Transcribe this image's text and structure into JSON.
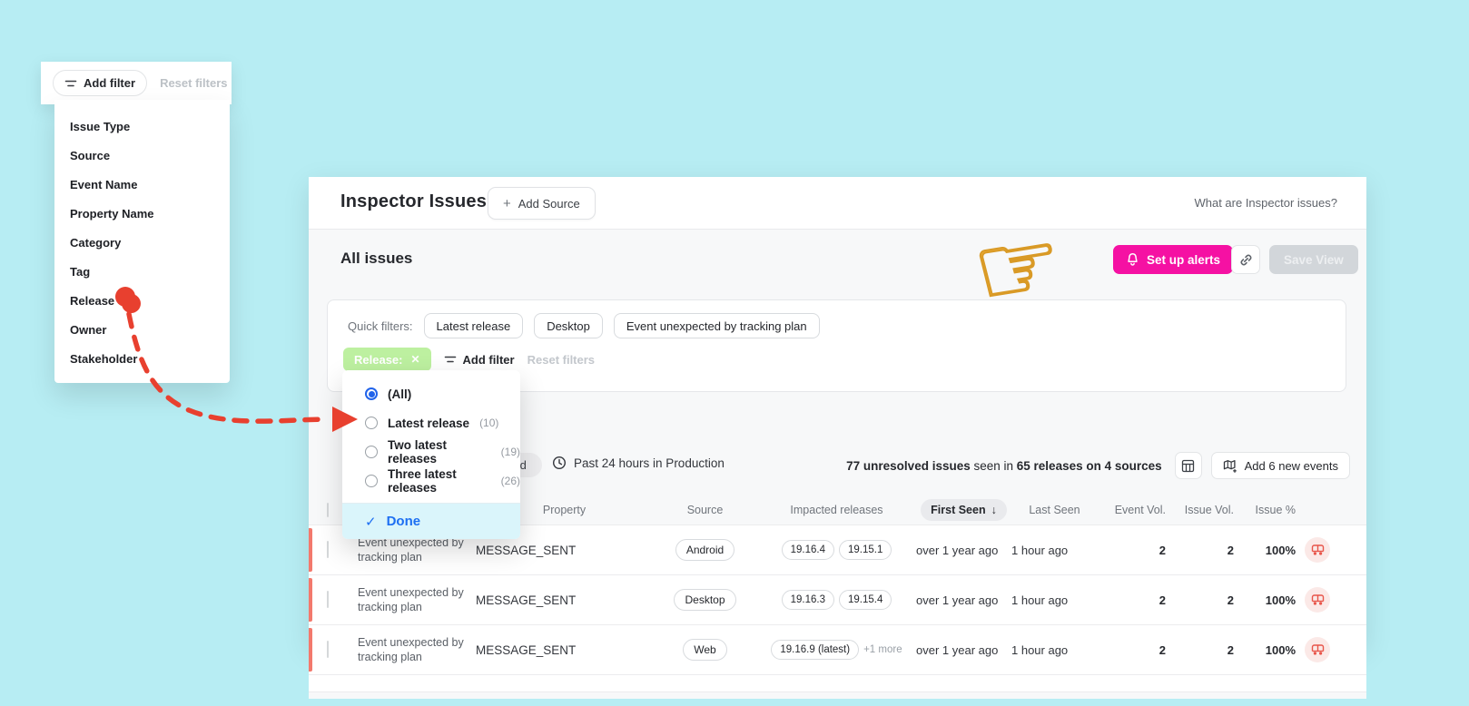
{
  "filter_menu": {
    "add_filter": "Add filter",
    "reset_filters": "Reset filters",
    "items": [
      "Issue Type",
      "Source",
      "Event Name",
      "Property Name",
      "Category",
      "Tag",
      "Release",
      "Owner",
      "Stakeholder"
    ]
  },
  "header": {
    "title": "Inspector Issues",
    "add_source": "Add Source",
    "help": "What are Inspector issues?"
  },
  "view_bar": {
    "title": "All issues",
    "pointer": "☞",
    "setup_alerts": "Set up alerts",
    "save_view": "Save View"
  },
  "quick_filters": {
    "label": "Quick filters:",
    "chips": [
      "Latest release",
      "Desktop",
      "Event unexpected by tracking plan"
    ],
    "release_chip": "Release:",
    "release_chip_close": "✕",
    "add_filter": "Add filter",
    "reset_filters": "Reset filters"
  },
  "release_dropdown": {
    "options": [
      {
        "label": "(All)",
        "count": ""
      },
      {
        "label": "Latest release",
        "count": "(10)"
      },
      {
        "label": "Two latest releases",
        "count": "(19)"
      },
      {
        "label": "Three latest releases",
        "count": "(26)"
      }
    ],
    "done": "Done"
  },
  "toolbar": {
    "status_pill": "Unresolved",
    "time_range": "Past 24 hours in Production",
    "summary_bold_1": "77 unresolved issues",
    "summary_mid": " seen in ",
    "summary_bold_2": "65 releases on 4 sources",
    "add_events": "Add 6 new events"
  },
  "table": {
    "headers": {
      "property": "Property",
      "source": "Source",
      "releases": "Impacted releases",
      "first_seen": "First Seen",
      "sort_arrow": "↓",
      "last_seen": "Last Seen",
      "event_vol": "Event Vol.",
      "issue_vol": "Issue Vol.",
      "issue_pct": "Issue %"
    },
    "rows": [
      {
        "issue": "Event unexpected by tracking plan",
        "property": "MESSAGE_SENT",
        "source": "Android",
        "rel1": "19.16.4",
        "rel2": "19.15.1",
        "more": "",
        "first": "over 1 year ago",
        "last": "1 hour ago",
        "event_vol": "2",
        "issue_vol": "2",
        "pct": "100%"
      },
      {
        "issue": "Event unexpected by tracking plan",
        "property": "MESSAGE_SENT",
        "source": "Desktop",
        "rel1": "19.16.3",
        "rel2": "19.15.4",
        "more": "",
        "first": "over 1 year ago",
        "last": "1 hour ago",
        "event_vol": "2",
        "issue_vol": "2",
        "pct": "100%"
      },
      {
        "issue": "Event unexpected by tracking plan",
        "property": "MESSAGE_SENT",
        "source": "Web",
        "rel1": "19.16.9 (latest)",
        "rel2": "",
        "more": "+1 more",
        "first": "over 1 year ago",
        "last": "1 hour ago",
        "event_vol": "2",
        "issue_vol": "2",
        "pct": "100%"
      }
    ]
  },
  "colors": {
    "background": "#b7edf3",
    "accent_magenta": "#f511a3",
    "accent_green_chip": "#bdf0a0",
    "accent_blue": "#1d6ff2",
    "accent_red": "#e8402f",
    "row_accent": "#f3796d"
  }
}
